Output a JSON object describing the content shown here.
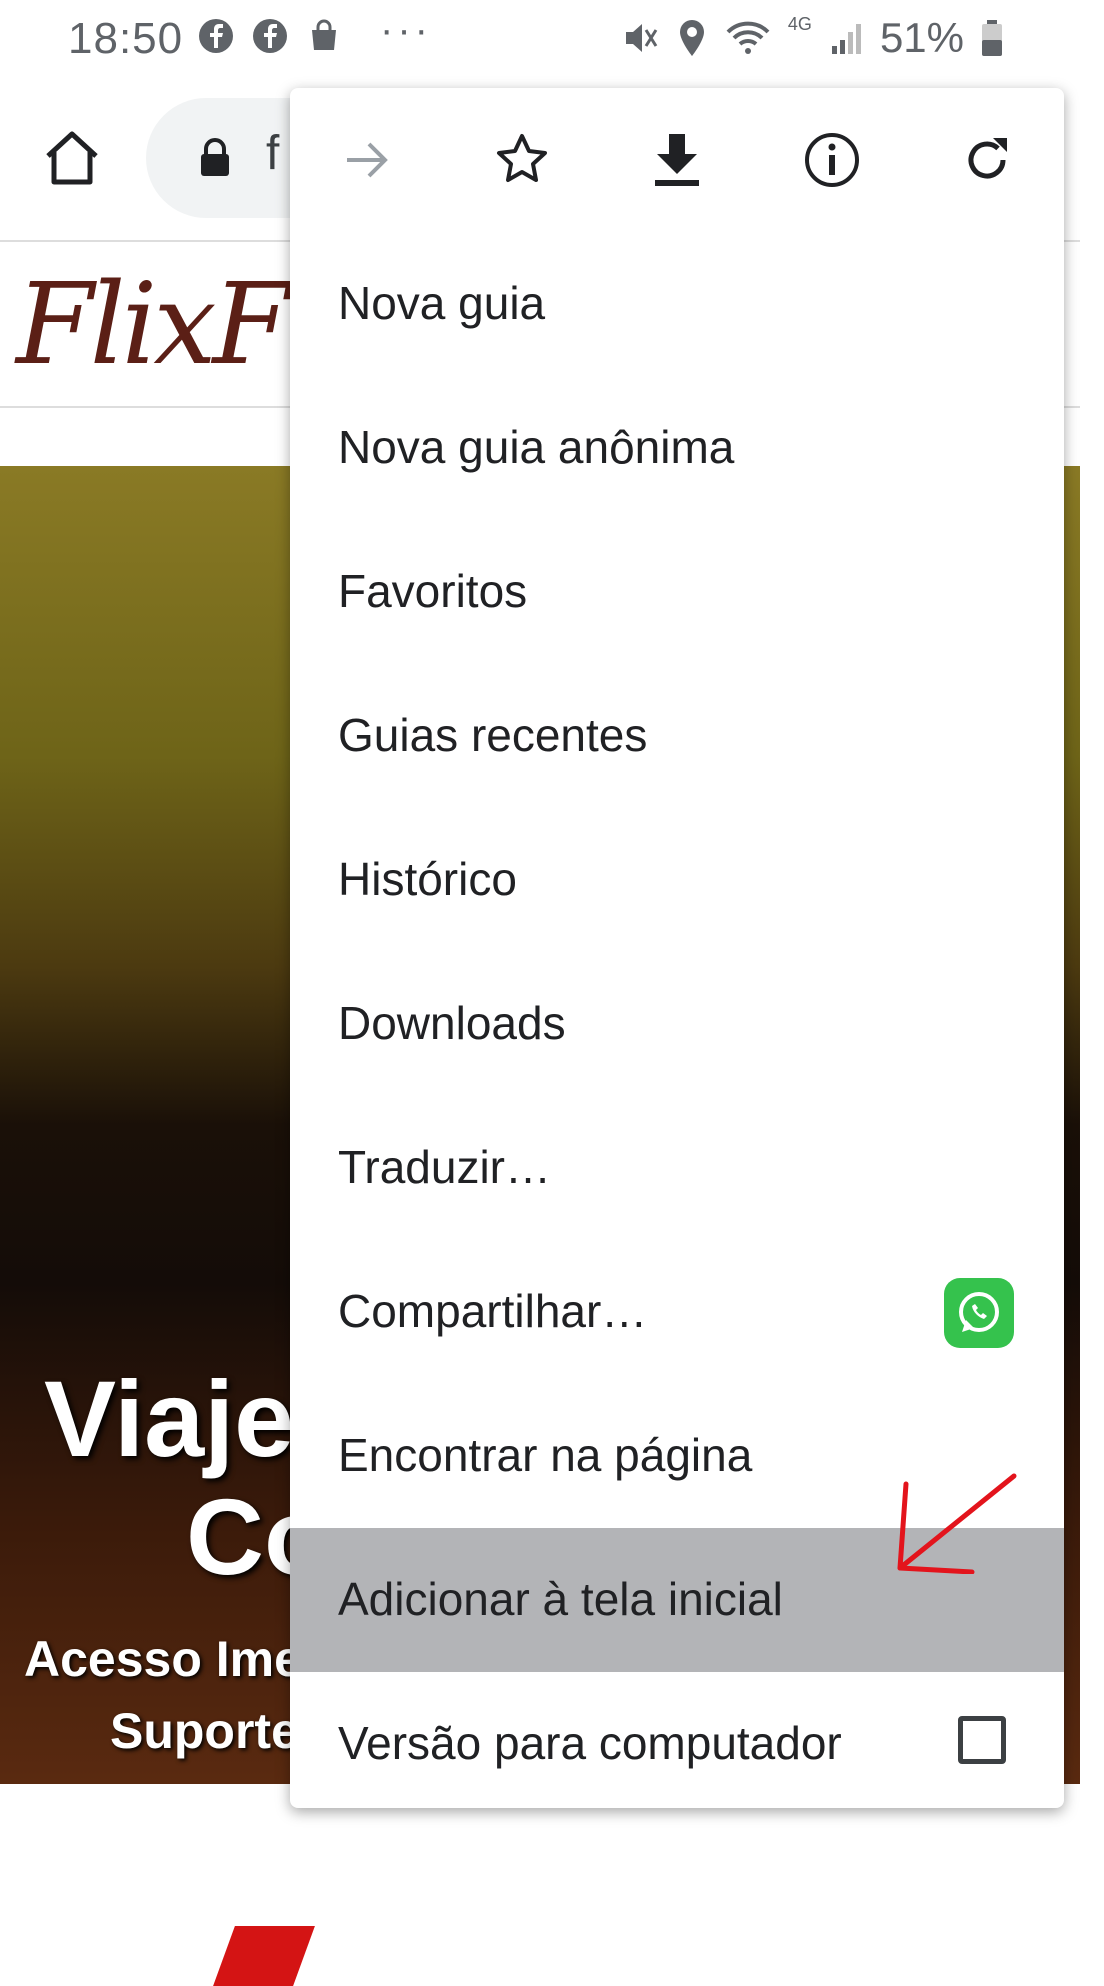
{
  "status_bar": {
    "time": "18:50",
    "left_icons": [
      "facebook-icon",
      "facebook-icon",
      "shopping-bag-icon"
    ],
    "more": "···",
    "network": "4G",
    "battery": "51%"
  },
  "toolbar": {
    "url_partial": "f"
  },
  "page": {
    "logo": "FlixF",
    "hero_title_line1": "Viaje",
    "hero_title_line2": "Co",
    "hero_sub_line1": "Acesso Ime",
    "hero_sub_line2": "Suporte"
  },
  "menu": {
    "icon_row": [
      "forward-icon",
      "bookmark-star-icon",
      "download-icon",
      "info-icon",
      "refresh-icon"
    ],
    "items": [
      {
        "label": "Nova guia"
      },
      {
        "label": "Nova guia anônima"
      },
      {
        "label": "Favoritos"
      },
      {
        "label": "Guias recentes"
      },
      {
        "label": "Histórico"
      },
      {
        "label": "Downloads"
      },
      {
        "label": "Traduzir…"
      },
      {
        "label": "Compartilhar…"
      },
      {
        "label": "Encontrar na página"
      },
      {
        "label": "Adicionar à tela inicial"
      },
      {
        "label": "Versão para computador"
      }
    ],
    "highlighted_item": "Adicionar à tela inicial"
  },
  "colors": {
    "menu_highlight": "#b3b4b7",
    "whatsapp": "#35c24d",
    "annotation_arrow": "#e3141c"
  }
}
